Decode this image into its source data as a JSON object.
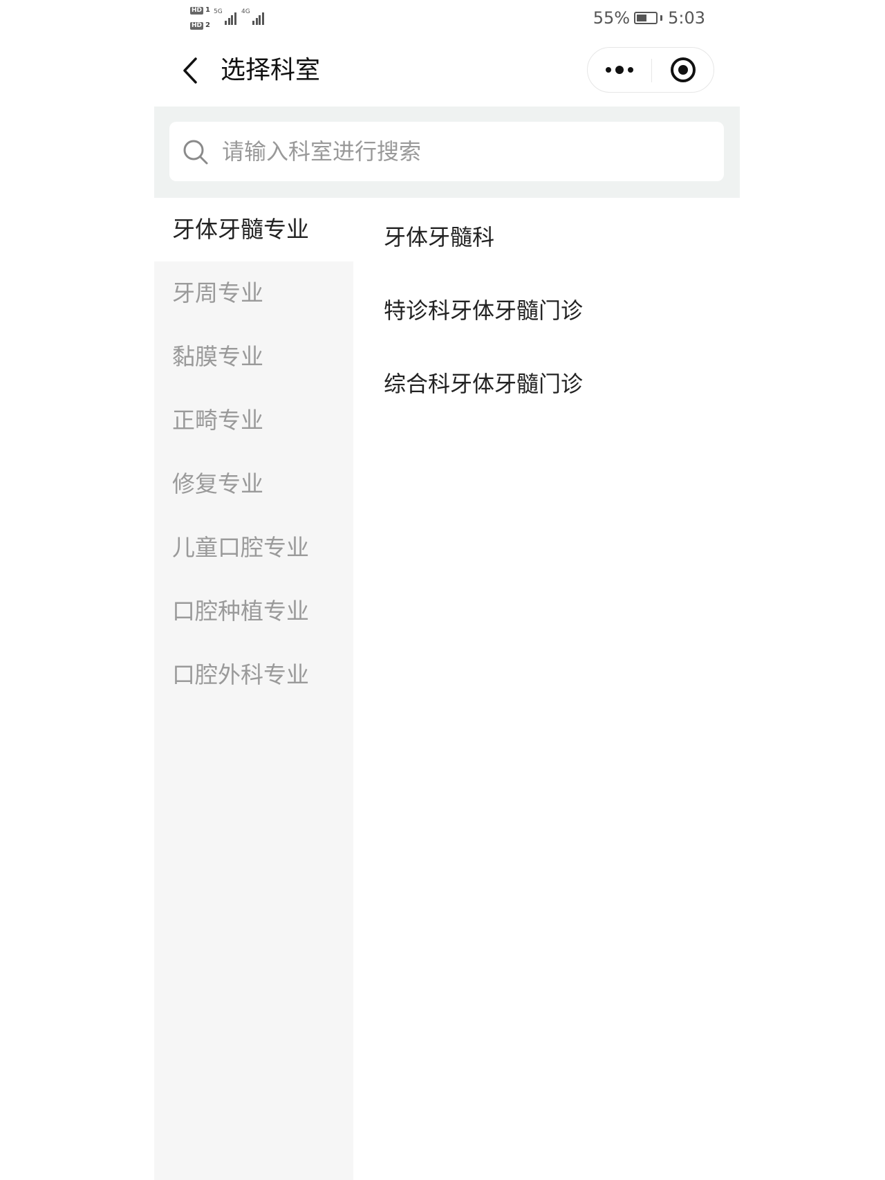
{
  "status_bar": {
    "sim1_badge": "HD",
    "sim1_number": "1",
    "sim2_badge": "HD",
    "sim2_number": "2",
    "network1": "5G",
    "network2": "4G",
    "battery_percent": "55%",
    "battery_level": 0.55,
    "time": "5:03"
  },
  "nav": {
    "title": "选择科室",
    "back_icon": "chevron-left-icon",
    "more_icon": "more-dots-icon",
    "close_icon": "target-close-icon"
  },
  "search": {
    "placeholder": "请输入科室进行搜索",
    "value": "",
    "icon": "search-icon",
    "background_color": "#eff2f1"
  },
  "sidebar": {
    "active_index": 0,
    "items": [
      {
        "label": "牙体牙髓专业"
      },
      {
        "label": "牙周专业"
      },
      {
        "label": "黏膜专业"
      },
      {
        "label": "正畸专业"
      },
      {
        "label": "修复专业"
      },
      {
        "label": "儿童口腔专业"
      },
      {
        "label": "口腔种植专业"
      },
      {
        "label": "口腔外科专业"
      }
    ],
    "background_color": "#f6f6f6",
    "inactive_text_color": "#9a9a9a",
    "active_text_color": "#222222"
  },
  "departments": {
    "items": [
      {
        "label": "牙体牙髓科"
      },
      {
        "label": "特诊科牙体牙髓门诊"
      },
      {
        "label": "综合科牙体牙髓门诊"
      }
    ]
  }
}
